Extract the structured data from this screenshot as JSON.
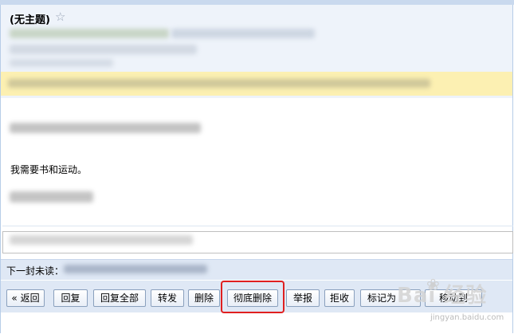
{
  "email": {
    "subject": "(无主题)",
    "star_icon": "star-outline-icon",
    "body_line": "我需要书和运动。"
  },
  "navigation": {
    "next_unread_label": "下一封未读："
  },
  "toolbar": {
    "back_label": "« 返回",
    "reply_label": "回复",
    "reply_all_label": "回复全部",
    "forward_label": "转发",
    "delete_label": "删除",
    "permanent_delete_label": "彻底删除",
    "report_label": "举报",
    "reject_label": "拒收",
    "mark_as_label": "标记为",
    "move_to_label": "移动到"
  },
  "watermark": {
    "text": "Bai 经验",
    "sub": "jingyan.baidu.com"
  },
  "colors": {
    "highlight": "#e02020",
    "notice_bg": "#fcf0b2",
    "header_bg": "#eef3fa"
  }
}
